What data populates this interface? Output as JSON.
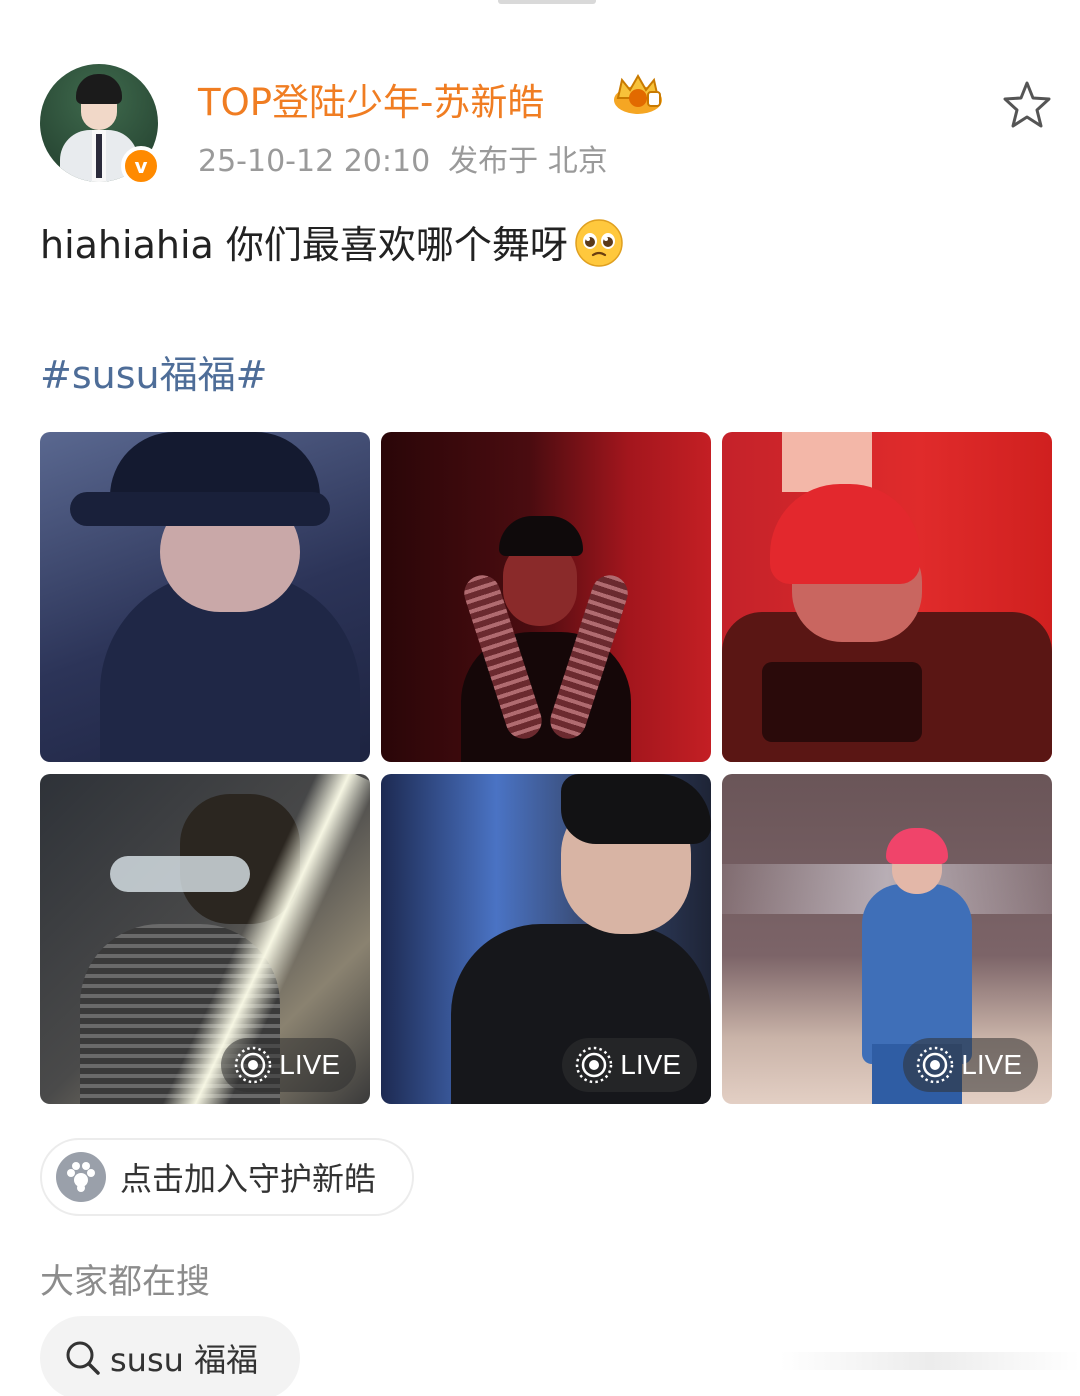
{
  "post": {
    "username": "TOP登陆少年-苏新皓",
    "verified_badge_letter": "v",
    "timestamp": "25-10-12 20:10",
    "location": "发布于 北京",
    "text": "hiahiahia 你们最喜欢哪个舞呀",
    "emoji": "pleading-face",
    "hashtag": "#susu福福#"
  },
  "photos": [
    {
      "live": false,
      "live_label": ""
    },
    {
      "live": false,
      "live_label": ""
    },
    {
      "live": false,
      "live_label": ""
    },
    {
      "live": true,
      "live_label": "LIVE"
    },
    {
      "live": true,
      "live_label": "LIVE"
    },
    {
      "live": true,
      "live_label": "LIVE"
    }
  ],
  "join_button": {
    "label": "点击加入守护新皓"
  },
  "search_section": {
    "title": "大家都在搜",
    "chip_label": "susu 福福"
  },
  "colors": {
    "username": "#f07d22",
    "hashtag": "#4e6d98",
    "badge": "#ff8a00",
    "meta": "#9a9a9a"
  },
  "icons": {
    "favorite": "star-outline-icon",
    "live": "live-photo-icon",
    "search": "search-icon",
    "crown": "crown-badge-icon"
  }
}
